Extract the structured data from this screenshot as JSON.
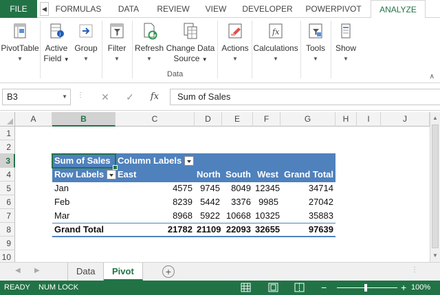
{
  "tabs": {
    "file": "FILE",
    "items": [
      "FORMULAS",
      "DATA",
      "REVIEW",
      "VIEW",
      "DEVELOPER",
      "POWERPIVOT",
      "ANALYZE"
    ],
    "active": "ANALYZE"
  },
  "ribbon": {
    "pivottable": "PivotTable",
    "active_field_1": "Active",
    "active_field_2": "Field",
    "group": "Group",
    "filter": "Filter",
    "refresh": "Refresh",
    "change_ds_1": "Change Data",
    "change_ds_2": "Source",
    "data_group_label": "Data",
    "actions": "Actions",
    "calculations": "Calculations",
    "tools": "Tools",
    "show": "Show",
    "accent_color": "#217346"
  },
  "formula_bar": {
    "name_box": "B3",
    "fx": "fx",
    "formula": "Sum of Sales"
  },
  "columns": [
    "A",
    "B",
    "C",
    "D",
    "E",
    "F",
    "G",
    "H",
    "I",
    "J"
  ],
  "rows": [
    "1",
    "2",
    "3",
    "4",
    "5",
    "6",
    "7",
    "8",
    "9",
    "10"
  ],
  "pivot": {
    "header_color": "#4f81bd",
    "values_label": "Sum of Sales",
    "column_labels": "Column Labels",
    "row_labels": "Row Labels",
    "col_headers": [
      "East",
      "North",
      "South",
      "West",
      "Grand Total"
    ],
    "data_rows": [
      {
        "label": "Jan",
        "values": [
          "4575",
          "9745",
          "8049",
          "12345",
          "34714"
        ]
      },
      {
        "label": "Feb",
        "values": [
          "8239",
          "5442",
          "3376",
          "9985",
          "27042"
        ]
      },
      {
        "label": "Mar",
        "values": [
          "8968",
          "5922",
          "10668",
          "10325",
          "35883"
        ]
      }
    ],
    "total": {
      "label": "Grand Total",
      "values": [
        "21782",
        "21109",
        "22093",
        "32655",
        "97639"
      ]
    }
  },
  "sheets": {
    "items": [
      "Data",
      "Pivot"
    ],
    "active": "Pivot",
    "add": "+"
  },
  "status": {
    "ready": "READY",
    "numlock": "NUM LOCK",
    "zoom_minus": "−",
    "zoom_plus": "+",
    "zoom": "100%"
  }
}
